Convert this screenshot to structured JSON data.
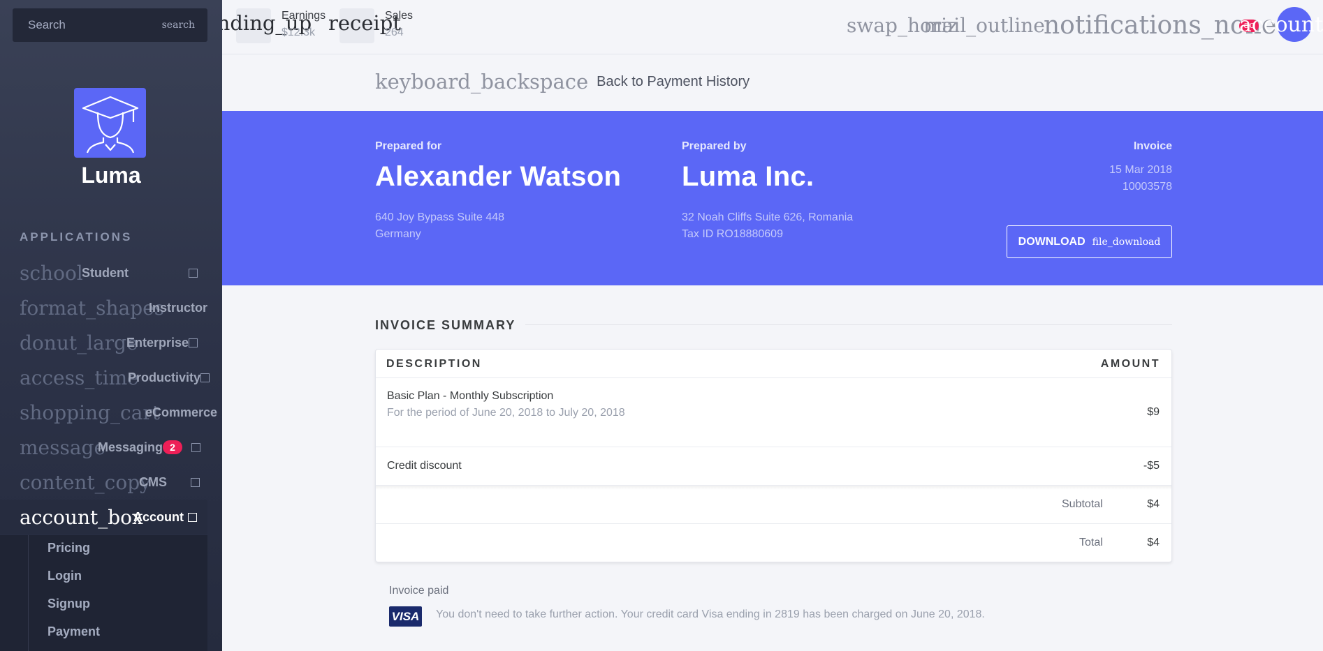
{
  "sidebar": {
    "search": {
      "placeholder": "Search",
      "icon": "search"
    },
    "brand": {
      "name": "Luma"
    },
    "heading": "APPLICATIONS",
    "items": [
      {
        "icon": "school",
        "label": "Student"
      },
      {
        "icon": "format_shapes",
        "label": "Instructor"
      },
      {
        "icon": "donut_large",
        "label": "Enterprise"
      },
      {
        "icon": "access_time",
        "label": "Productivity"
      },
      {
        "icon": "shopping_cart",
        "label": "eCommerce"
      },
      {
        "icon": "message",
        "label": "Messaging",
        "badge": "2"
      },
      {
        "icon": "content_copy",
        "label": "CMS"
      },
      {
        "icon": "account_box",
        "label": "Account"
      }
    ],
    "submenu": [
      "Pricing",
      "Login",
      "Signup",
      "Payment"
    ]
  },
  "topbar": {
    "stats": [
      {
        "icon": "trending_up",
        "label": "Earnings",
        "value": "$12.3k"
      },
      {
        "icon": "receipt",
        "label": "Sales",
        "value": "264"
      }
    ],
    "icons": {
      "swap": "swap_horiz",
      "mail": "mail_outline",
      "notifications": "notifications_none",
      "notif_badge": "ac",
      "account": "account_b"
    }
  },
  "back": {
    "icon": "keyboard_backspace",
    "label": "Back to Payment History"
  },
  "invoice": {
    "prepared_for": {
      "label": "Prepared for",
      "name": "Alexander Watson",
      "address1": "640 Joy Bypass Suite 448",
      "address2": "Germany"
    },
    "prepared_by": {
      "label": "Prepared by",
      "name": "Luma Inc.",
      "address1": "32 Noah Cliffs Suite 626, Romania",
      "address2": "Tax ID RO18880609"
    },
    "label": "Invoice",
    "date": "15 Mar 2018",
    "number": "10003578",
    "download": {
      "label": "DOWNLOAD",
      "icon": "file_download"
    }
  },
  "summary": {
    "title": "INVOICE SUMMARY",
    "columns": {
      "description": "DESCRIPTION",
      "amount": "AMOUNT"
    },
    "rows": [
      {
        "title": "Basic Plan - Monthly Subscription",
        "subtitle": "For the period of June 20, 2018 to July 20, 2018",
        "amount": "$9"
      },
      {
        "title": "Credit discount",
        "amount": "-$5"
      }
    ],
    "subtotal": {
      "label": "Subtotal",
      "value": "$4"
    },
    "total": {
      "label": "Total",
      "value": "$4"
    }
  },
  "payment": {
    "status": "Invoice paid",
    "card": "VISA",
    "message": "You don't need to take further action. Your credit card Visa ending in 2819 has been charged on June 20, 2018."
  }
}
